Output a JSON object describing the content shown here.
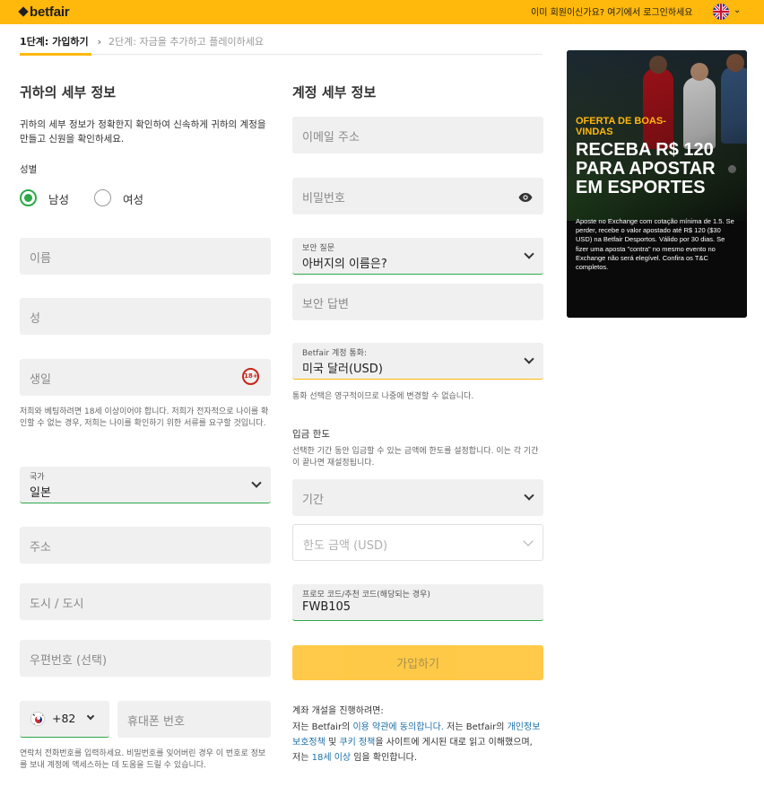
{
  "header": {
    "logo": "betfair",
    "login_prompt": "이미 회원이신가요? 여기에서 로그인하세요"
  },
  "steps": {
    "step1": "1단계: 가입하기",
    "step2": "2단계: 자금을 추가하고 플레이하세요"
  },
  "personal": {
    "title": "귀하의 세부 정보",
    "description": "귀하의 세부 정보가 정확한지 확인하여 신속하게 귀하의 계정을 만들고 신원을 확인하세요.",
    "gender_label": "성별",
    "gender_male": "남성",
    "gender_female": "여성",
    "gender_selected": "남성",
    "first_name_placeholder": "이름",
    "last_name_placeholder": "성",
    "birthdate_placeholder": "생일",
    "age_badge": "18+",
    "age_note": "저희와 베팅하려면 18세 이상이어야 합니다. 저희가 전자적으로 나이를 확인할 수 없는 경우, 저희는 나이를 확인하기 위한 서류를 요구할 것입니다.",
    "country_label": "국가",
    "country_value": "일본",
    "address_placeholder": "주소",
    "city_placeholder": "도시 / 도시",
    "postal_placeholder": "우편번호 (선택)",
    "dial_code": "+82",
    "phone_placeholder": "휴대폰 번호",
    "phone_note": "연락처 전화번호를 입력하세요. 비밀번호를 잊어버린 경우 이 번호로 정보를 보내 계정에 액세스하는 데 도움을 드릴 수 있습니다."
  },
  "account": {
    "title": "계정 세부 정보",
    "email_placeholder": "이메일 주소",
    "password_placeholder": "비밀번호",
    "security_q_label": "보안 질문",
    "security_q_value": "아버지의 이름은?",
    "security_a_placeholder": "보안 답변",
    "currency_label": "Betfair 계정 통화:",
    "currency_value": "미국 달러(USD)",
    "currency_note": "통화 선택은 영구적이므로 나중에 변경할 수 없습니다.",
    "deposit_title": "입금 한도",
    "deposit_note": "선택한 기간 동안 입금할 수 있는 금액에 한도를 설정합니다. 이는 각 기간이 끝나면 재설정됩니다.",
    "period_placeholder": "기간",
    "limit_placeholder": "한도 금액 (USD)",
    "promo_label": "프로모 코드/추천 코드(해당되는 경우)",
    "promo_value": "FWB105",
    "signup_button": "가입하기",
    "legal_title": "계좌 개설을 진행하려면:",
    "legal_1": "저는 Betfair의 ",
    "legal_link_terms": "이용 약관에 동의합니다.",
    "legal_2": " 저는 Betfair의 ",
    "legal_link_privacy": "개인정보 보호정책",
    "legal_3": " 및 ",
    "legal_link_cookie": "쿠키 정책",
    "legal_4": "을 사이트에 게시된 대로 읽고 이해했으며, 저는 ",
    "legal_link_age": "18세 이상",
    "legal_5": " 임을 확인합니다."
  },
  "promo_banner": {
    "subtitle": "OFERTA DE BOAS-VINDAS",
    "headline": "RECEBA R$ 120 PARA APOSTAR EM ESPORTES",
    "fine_print": "Aposte no Exchange com cotação mínima de 1.5. Se perder, recebe o valor apostado até R$ 120 ($30 USD) na Betfair Desportos. Válido por 30 dias. Se fizer uma aposta \"contra\" no mesmo evento no Exchange não será elegível. Confira os T&C completos."
  },
  "colors": {
    "brand_yellow": "#ffb80c",
    "success_green": "#2ea84a",
    "link_blue": "#1d6fa8",
    "age_red": "#c7271b"
  }
}
